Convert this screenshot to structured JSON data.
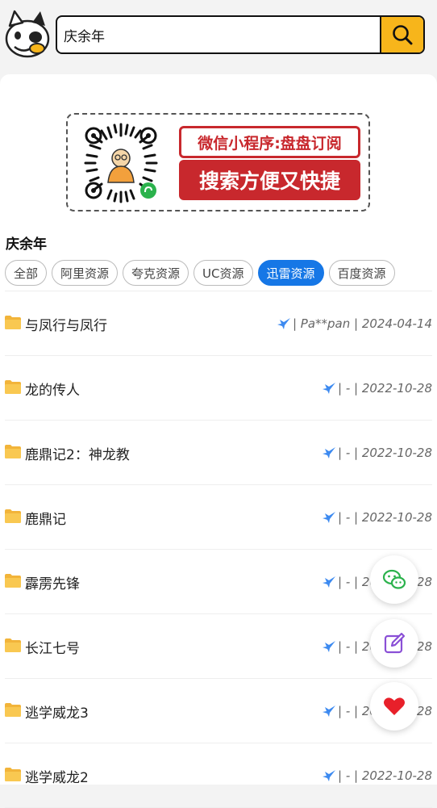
{
  "search": {
    "value": "庆余年"
  },
  "banner": {
    "line1": "微信小程序:盘盘订阅",
    "line2": "搜索方便又快捷"
  },
  "query_title": "庆余年",
  "tabs": [
    {
      "label": "全部",
      "active": false
    },
    {
      "label": "阿里资源",
      "active": false
    },
    {
      "label": "夸克资源",
      "active": false
    },
    {
      "label": "UC资源",
      "active": false
    },
    {
      "label": "迅雷资源",
      "active": true
    },
    {
      "label": "百度资源",
      "active": false
    }
  ],
  "results": [
    {
      "title": "与凤行与凤行",
      "meta": "| Pa**pan | 2024-04-14"
    },
    {
      "title": "龙的传人",
      "meta": "| - | 2022-10-28"
    },
    {
      "title": "鹿鼎记2：神龙教",
      "meta": "| - | 2022-10-28"
    },
    {
      "title": "鹿鼎记",
      "meta": "| - | 2022-10-28"
    },
    {
      "title": "霹雳先锋",
      "meta": "| - | 2022-10-28"
    },
    {
      "title": "长江七号",
      "meta": "| - | 2022-10-28"
    },
    {
      "title": "逃学威龙3",
      "meta": "| - | 2022-10-28"
    },
    {
      "title": "逃学威龙2",
      "meta": "| - | 2022-10-28"
    }
  ],
  "icons": {
    "logo": "dog-logo-icon",
    "search": "magnifier-icon",
    "row_folder": "folder-icon",
    "row_source": "thunder-bird-icon",
    "fab_wechat": "wechat-icon",
    "fab_edit": "edit-icon",
    "fab_favorite": "heart-icon"
  },
  "colors": {
    "accent": "#f7b51b",
    "tab_active": "#1677e6",
    "banner_red": "#c8282d",
    "heart": "#e8202a",
    "wechat": "#2bb24c",
    "edit": "#8a4fd6"
  }
}
